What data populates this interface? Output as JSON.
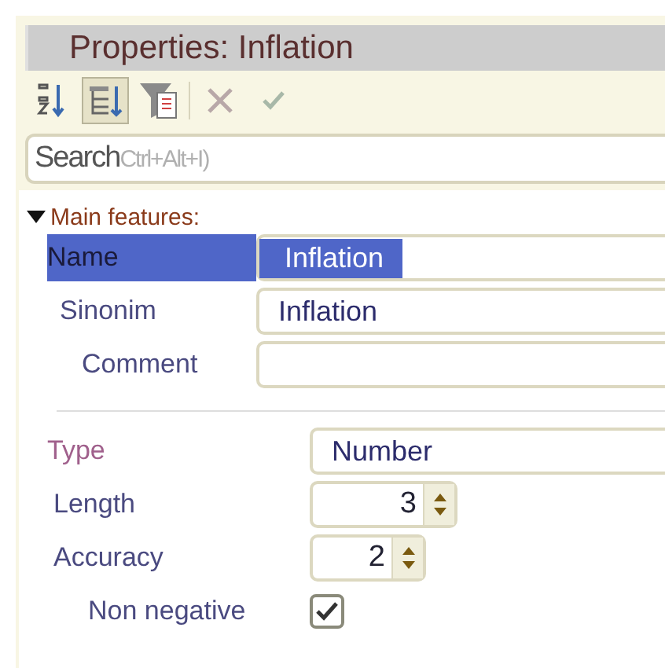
{
  "window": {
    "title": "Properties: Inflation"
  },
  "toolbar": [
    {
      "kind": "sort",
      "selected": false
    },
    {
      "kind": "tree",
      "selected": true
    },
    {
      "kind": "filter",
      "selected": false
    },
    {
      "kind": "cancel",
      "selected": false,
      "disabled": true
    },
    {
      "kind": "apply",
      "selected": false,
      "disabled": true
    }
  ],
  "search": {
    "value": "Search",
    "placeholder": "Ctrl+Alt+I)"
  },
  "section": {
    "title": "Main features:",
    "expanded": true
  },
  "groups": [
    {
      "rows": [
        {
          "label": "Name",
          "kind": "text",
          "value": "Inflation",
          "selected": true
        },
        {
          "label": "Sinonim",
          "kind": "text",
          "value": "Inflation",
          "selected": false,
          "color": "#4a4a80"
        },
        {
          "label": "Comment",
          "kind": "text",
          "selected": false,
          "color": "#4a4a80"
        }
      ]
    },
    {
      "rows": [
        {
          "label": "Type",
          "kind": "text",
          "value": "Number",
          "selected": false,
          "color": "#a0608c"
        },
        {
          "label": "Length",
          "kind": "spin",
          "value": "3",
          "selected": false,
          "color": "#4a4a80"
        },
        {
          "label": "Accuracy",
          "kind": "spin",
          "value": "2",
          "selected": false,
          "color": "#4a4a80"
        },
        {
          "label": "Non negative",
          "kind": "check",
          "checked": true,
          "selected": false,
          "color": "#4a4a80"
        }
      ]
    }
  ]
}
